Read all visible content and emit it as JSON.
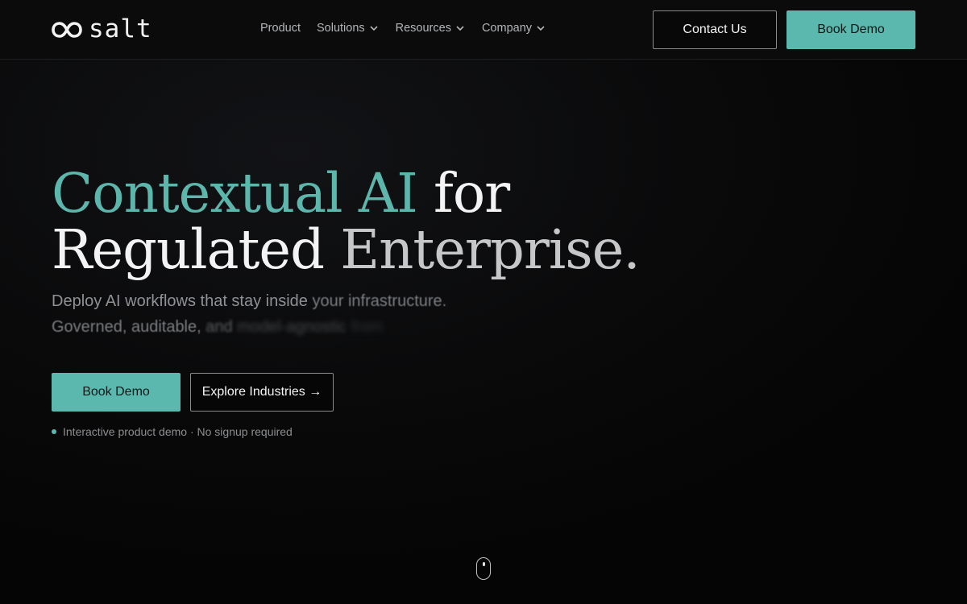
{
  "brand": {
    "name": "salt",
    "icon": "infinity-logo-icon"
  },
  "nav": {
    "items": [
      {
        "label": "Product",
        "has_dropdown": false
      },
      {
        "label": "Solutions",
        "has_dropdown": true
      },
      {
        "label": "Resources",
        "has_dropdown": true
      },
      {
        "label": "Company",
        "has_dropdown": true
      }
    ],
    "contact_label": "Contact Us",
    "demo_label": "Book Demo"
  },
  "hero": {
    "title_accent": "Contextual AI",
    "title_for": "for",
    "title_regulated": "Regulated",
    "title_enterprise": "Enterprise.",
    "subtitle_line1_a": "Deploy AI workflows that stay inside",
    "subtitle_line1_b": "your infrastructure.",
    "subtitle_line2_a": "Governed, auditable,",
    "subtitle_line2_b": "and",
    "subtitle_line2_c": "model-agnostic",
    "subtitle_line2_d": "from",
    "primary_cta": "Book Demo",
    "secondary_cta": "Explore Industries →",
    "note": "Interactive product demo · No signup required"
  },
  "colors": {
    "accent": "#5ab8ae",
    "background": "#0a0a0b",
    "text": "#f3f3f3"
  }
}
